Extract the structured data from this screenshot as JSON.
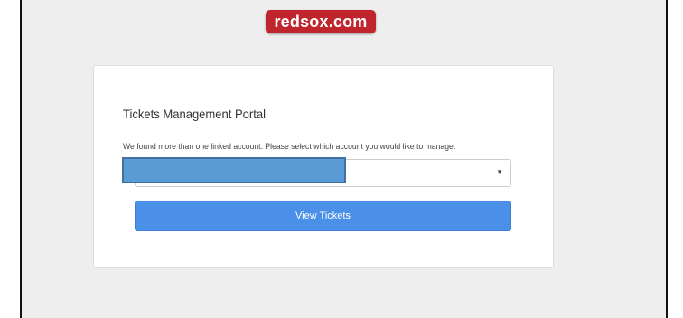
{
  "header": {
    "logo_brand": "redsox",
    "logo_tld": ".com",
    "logo_color": "#c0252e"
  },
  "portal": {
    "title": "Tickets Management Portal",
    "message": "We found more than one linked account. Please select which account you would like to manage.",
    "account_select": {
      "selected_value": "",
      "redacted": true,
      "arrow_icon": "caret-down-icon"
    },
    "view_button_label": "View Tickets",
    "accent_color": "#4a8fe8"
  }
}
